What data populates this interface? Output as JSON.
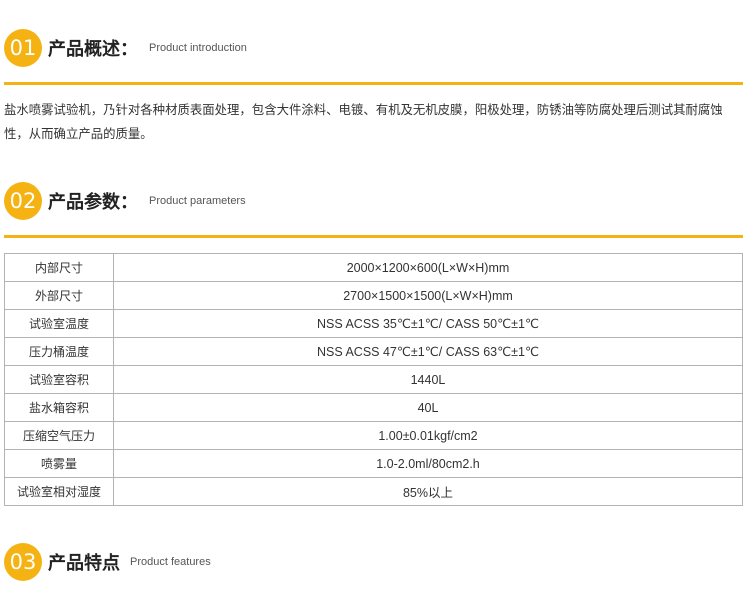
{
  "sections": {
    "intro": {
      "number": "01",
      "title": "产品概述：",
      "subtitle": "Product introduction",
      "text": "盐水喷雾试验机，乃针对各种材质表面处理，包含大件涂料、电镀、有机及无机皮膜，阳极处理，防锈油等防腐处理后测试其耐腐蚀性，从而确立产品的质量。"
    },
    "params": {
      "number": "02",
      "title": "产品参数：",
      "subtitle": "Product parameters",
      "rows": [
        {
          "label": "内部尺寸",
          "value": "2000×1200×600(L×W×H)mm"
        },
        {
          "label": "外部尺寸",
          "value": "2700×1500×1500(L×W×H)mm"
        },
        {
          "label": "试验室温度",
          "value": "NSS ACSS 35℃±1℃/ CASS 50℃±1℃"
        },
        {
          "label": "压力桶温度",
          "value": "NSS ACSS 47℃±1℃/ CASS 63℃±1℃"
        },
        {
          "label": "试验室容积",
          "value": "1440L"
        },
        {
          "label": "盐水箱容积",
          "value": "40L"
        },
        {
          "label": "压缩空气压力",
          "value": "1.00±0.01kgf/cm2"
        },
        {
          "label": "喷雾量",
          "value": "1.0-2.0ml/80cm2.h"
        },
        {
          "label": "试验室相对湿度",
          "value": "85%以上"
        }
      ]
    },
    "features": {
      "number": "03",
      "title": "产品特点",
      "subtitle": "Product features"
    }
  },
  "colors": {
    "accent": "#f5b213",
    "border": "#b3b3b3",
    "text": "#333333"
  }
}
